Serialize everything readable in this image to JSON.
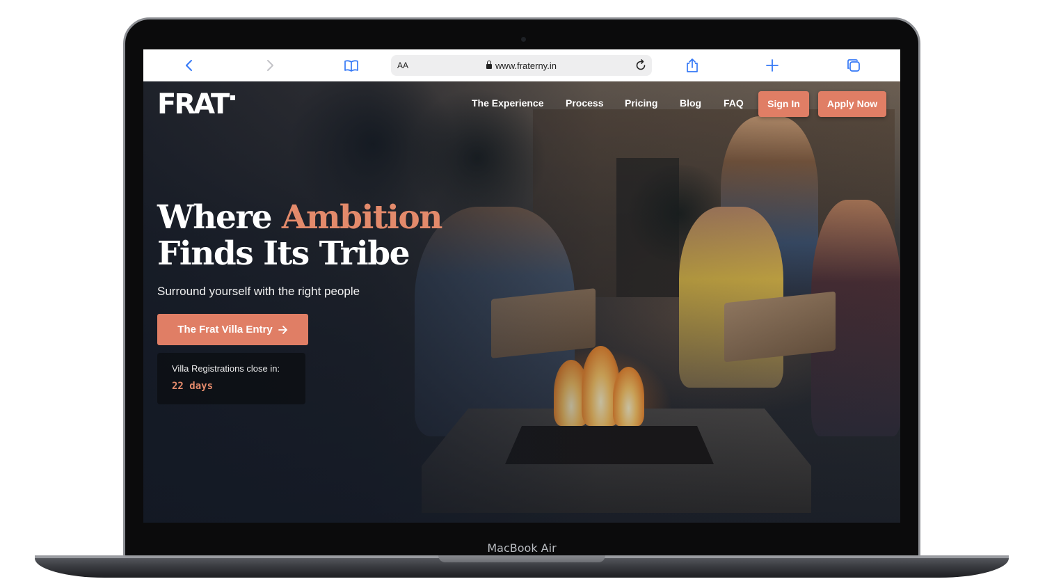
{
  "device": {
    "label": "MacBook Air"
  },
  "browser": {
    "aa_label": "AA",
    "url": "www.fraterny.in",
    "icons": [
      "back-icon",
      "forward-icon",
      "bookmarks-icon",
      "lock-icon",
      "reload-icon",
      "share-icon",
      "new-tab-icon",
      "tabs-icon"
    ]
  },
  "site": {
    "logo": "FRAT",
    "nav": [
      "The Experience",
      "Process",
      "Pricing",
      "Blog",
      "FAQ"
    ],
    "sign_in": "Sign In",
    "apply_now": "Apply Now",
    "headline_part1": "Where ",
    "headline_accent": "Ambition",
    "headline_line2": "Finds Its Tribe",
    "subline": "Surround yourself with the right people",
    "cta_label": "The Frat Villa Entry",
    "countdown_label": "Villa Registrations close in:",
    "countdown_value": "22 days"
  },
  "colors": {
    "accent": "#e07e65",
    "accent_text": "#e38a6b",
    "browser_icon": "#3478f6"
  }
}
